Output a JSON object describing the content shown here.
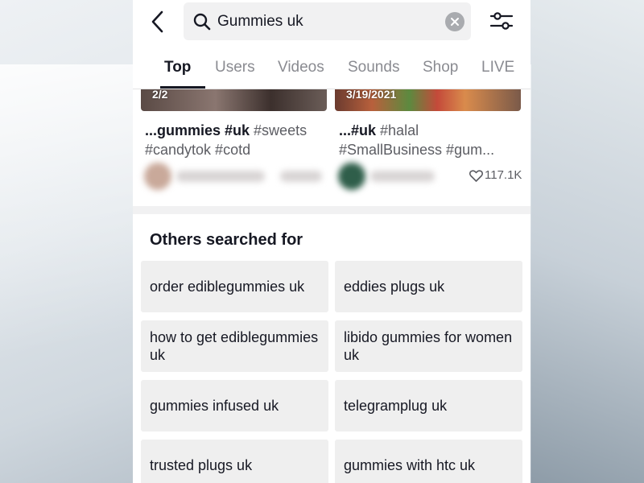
{
  "search": {
    "query": "Gummies uk"
  },
  "tabs": [
    {
      "label": "Top",
      "active": true
    },
    {
      "label": "Users",
      "active": false
    },
    {
      "label": "Videos",
      "active": false
    },
    {
      "label": "Sounds",
      "active": false
    },
    {
      "label": "Shop",
      "active": false
    },
    {
      "label": "LIVE",
      "active": false
    }
  ],
  "videos": [
    {
      "thumb_label": "2/2",
      "caption_bold": "...gummies #uk",
      "caption_rest": " #sweets #candytok #cotd"
    },
    {
      "thumb_label": "3/19/2021",
      "caption_bold": "...#uk",
      "caption_rest": " #halal #SmallBusiness #gum...",
      "likes": "117.1K"
    }
  ],
  "others": {
    "title": "Others searched for",
    "items": [
      "order ediblegummies uk",
      "eddies plugs uk",
      "how to get ediblegummies uk",
      "libido gummies for women uk",
      "gummies infused uk",
      "telegramplug uk",
      "trusted plugs uk",
      "gummies with htc uk"
    ]
  },
  "colors": {
    "text_primary": "#161823",
    "text_secondary": "#8a8b91",
    "chip_bg": "#efefef"
  },
  "icons": [
    "back-arrow-icon",
    "search-icon",
    "clear-icon",
    "filter-sliders-icon",
    "heart-icon"
  ]
}
